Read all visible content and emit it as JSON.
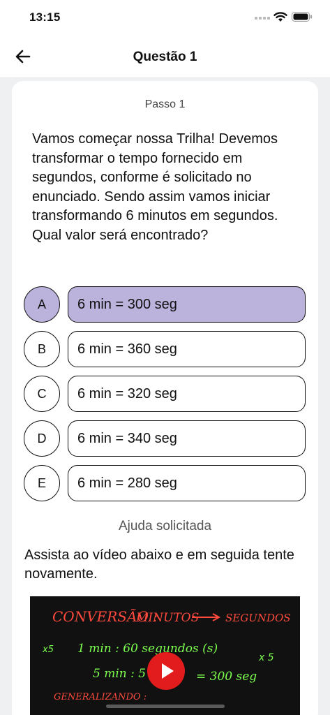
{
  "status": {
    "time": "13:15"
  },
  "header": {
    "title": "Questão 1"
  },
  "card": {
    "step": "Passo 1",
    "question": "Vamos começar nossa Trilha! Devemos transformar o tempo fornecido em segundos, conforme é solicitado no enunciado. Sendo assim vamos iniciar transformando 6 minutos em segundos. Qual valor será encontrado?",
    "options": [
      {
        "letter": "A",
        "text": "6 min = 300 seg",
        "selected": true
      },
      {
        "letter": "B",
        "text": "6 min = 360 seg",
        "selected": false
      },
      {
        "letter": "C",
        "text": "6 min = 320 seg",
        "selected": false
      },
      {
        "letter": "D",
        "text": "6 min = 340 seg",
        "selected": false
      },
      {
        "letter": "E",
        "text": "6 min = 280 seg",
        "selected": false
      }
    ],
    "help_title": "Ajuda solicitada",
    "help_text": "Assista ao vídeo abaixo e em seguida tente novamente.",
    "video": {
      "title_left": "CONVERSÃO :",
      "title_mid": "MINUTOS",
      "title_right": "SEGUNDOS",
      "line1": "1 min : 60 segundos (s)",
      "line2": "5 min : 5",
      "line2_result": "= 300 seg",
      "mult_left": "x5",
      "mult_right": "x 5",
      "line3": "GENERALIZANDO :"
    }
  },
  "colors": {
    "selected": "#bbb3dc",
    "play": "#e21c1c"
  }
}
